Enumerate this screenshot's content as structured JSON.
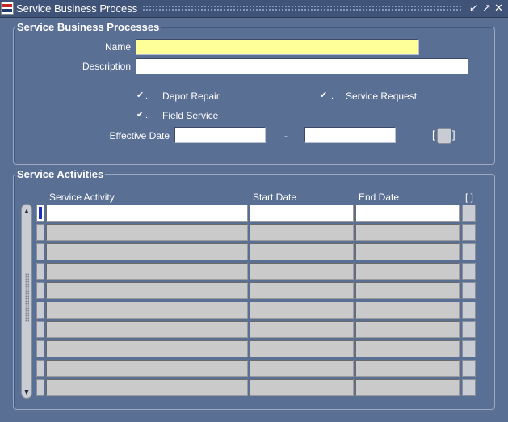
{
  "window": {
    "title": "Service Business Process",
    "minimize_glyph": "↙",
    "maximize_glyph": "↗",
    "close_glyph": "✕"
  },
  "header_section": {
    "title": "Service Business Processes",
    "name_label": "Name",
    "name_value": "",
    "description_label": "Description",
    "description_value": "",
    "checkboxes": [
      {
        "label": "Depot Repair",
        "checked": true
      },
      {
        "label": "Service Request",
        "checked": true
      },
      {
        "label": "Field Service",
        "checked": true
      }
    ],
    "effective_date_label": "Effective Date",
    "date_separator": "-",
    "effective_from": "",
    "effective_to": "",
    "dff_bracket_open": "[",
    "dff_bracket_close": "]"
  },
  "activities_section": {
    "title": "Service Activities",
    "columns": [
      "Service Activity",
      "Start Date",
      "End Date",
      "[ ]"
    ],
    "rows": [
      [
        "",
        "",
        ""
      ],
      [
        "",
        "",
        ""
      ],
      [
        "",
        "",
        ""
      ],
      [
        "",
        "",
        ""
      ],
      [
        "",
        "",
        ""
      ],
      [
        "",
        "",
        ""
      ],
      [
        "",
        "",
        ""
      ],
      [
        "",
        "",
        ""
      ],
      [
        "",
        "",
        ""
      ],
      [
        "",
        "",
        ""
      ]
    ]
  },
  "icons": {
    "app_icon": "oracle-forms-icon",
    "checkbox": "check-icon",
    "scroll_up": "up-arrow-icon",
    "scroll_down": "down-arrow-icon"
  },
  "colors": {
    "background": "#5a6f94",
    "titlebar": "#3f5478",
    "required_field": "#ffff99",
    "current_row_marker": "#1d2fc0"
  }
}
